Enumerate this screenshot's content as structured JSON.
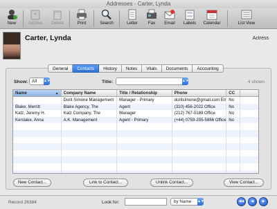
{
  "window": {
    "title": "Addresses - Carter, Lynda"
  },
  "toolbar": {
    "items": [
      {
        "label": "New",
        "icon": "new-contact-icon",
        "enabled": true
      },
      {
        "label": "Archive",
        "icon": "archive-icon",
        "enabled": false
      },
      {
        "label": "Delete",
        "icon": "delete-icon",
        "enabled": false
      },
      {
        "label": "Print",
        "icon": "printer-icon",
        "enabled": true
      },
      {
        "label": "Search",
        "icon": "search-icon",
        "enabled": true
      },
      {
        "label": "Letter",
        "icon": "letter-icon",
        "enabled": true
      },
      {
        "label": "Fax",
        "icon": "fax-icon",
        "enabled": true
      },
      {
        "label": "Email",
        "icon": "email-icon",
        "enabled": true
      },
      {
        "label": "Labels",
        "icon": "labels-icon",
        "enabled": true
      },
      {
        "label": "Calendar",
        "icon": "calendar-icon",
        "enabled": true
      },
      {
        "label": "List View",
        "icon": "list-view-icon",
        "enabled": true
      }
    ]
  },
  "contact": {
    "name": "Carter, Lynda",
    "role": "Actress"
  },
  "tabs": [
    {
      "label": "General",
      "active": false
    },
    {
      "label": "Contacts",
      "active": true
    },
    {
      "label": "History",
      "active": false
    },
    {
      "label": "Notes",
      "active": false
    },
    {
      "label": "Vitals",
      "active": false
    },
    {
      "label": "Documents",
      "active": false
    },
    {
      "label": "Accounting",
      "active": false
    }
  ],
  "filters": {
    "show_label": "Show:",
    "show_value": "All",
    "title_label": "Title:",
    "title_value": "",
    "count_text": "4 shown"
  },
  "table": {
    "columns": [
      "Name",
      "Company Name",
      "Title / Relationship",
      "Phone",
      "CC",
      ""
    ],
    "rows": [
      [
        "",
        "Dorit Simone Management",
        "Manager - Primary",
        "doritsimone@gmail.com Em",
        "No",
        ""
      ],
      [
        "Blake, Merritt",
        "Blake Agency, The",
        "Agent",
        "(310) 456-2022 Office",
        "No",
        ""
      ],
      [
        "Katz, Jeremy H.",
        "Katz Company, The",
        "Manager",
        "(212) 767-0189 Office",
        "No",
        ""
      ],
      [
        "Kerslake, Anna",
        "A.K. Management",
        "Agent - Primary",
        "(+44) 0759-255-5866 Office",
        "No",
        ""
      ]
    ],
    "empty_rows": 8
  },
  "buttons": {
    "new_contact": "New Contact...",
    "link_contact": "Link to Contact...",
    "unlink_contact": "Unlink Contact...",
    "view_contact": "View Contact..."
  },
  "status": {
    "record": "Record 26384",
    "look_for_label": "Look for:",
    "look_for_value": "",
    "by_value": "by Name"
  },
  "colors": {
    "accent": "#2f73d9",
    "row_alt": "#edf3fe"
  }
}
